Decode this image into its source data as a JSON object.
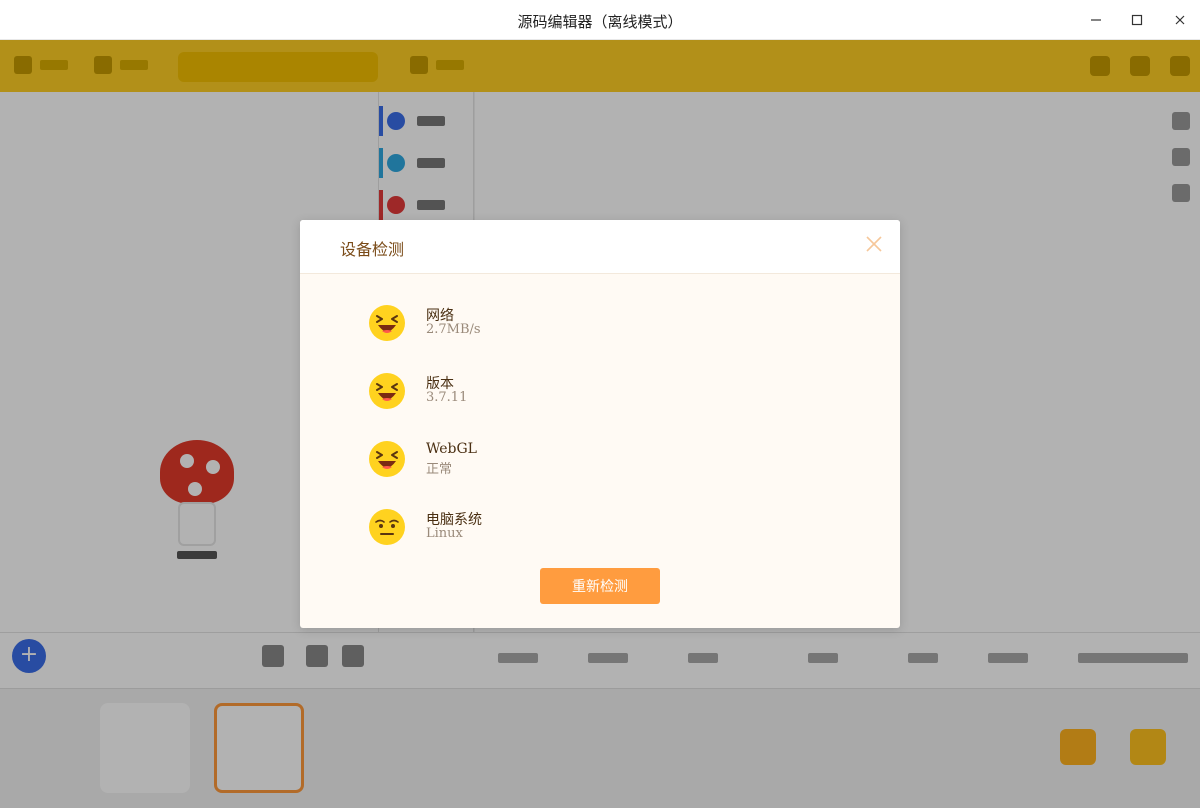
{
  "window": {
    "title": "源码编辑器（离线模式）",
    "minimize_glyph": "—",
    "maximize_glyph": "☐",
    "close_glyph": "✕"
  },
  "dialog": {
    "title": "设备检测",
    "close_glyph": "✕",
    "checks": [
      {
        "name": "网络",
        "value": "2.7MB/s",
        "status_icon": "laughing-face-icon"
      },
      {
        "name": "版本",
        "value": "3.7.11",
        "status_icon": "laughing-face-icon"
      },
      {
        "name": "WebGL",
        "value": "正常",
        "status_icon": "laughing-face-icon"
      },
      {
        "name": "电脑系统",
        "value": "Linux",
        "status_icon": "neutral-face-icon"
      }
    ],
    "retry_label": "重新检测"
  },
  "colors": {
    "toolbar": "#ffcf24",
    "accent": "#ff9c3f",
    "face": "#ffd21f",
    "dialog_bg": "#fffaf4",
    "title_text": "#7a4b18"
  }
}
